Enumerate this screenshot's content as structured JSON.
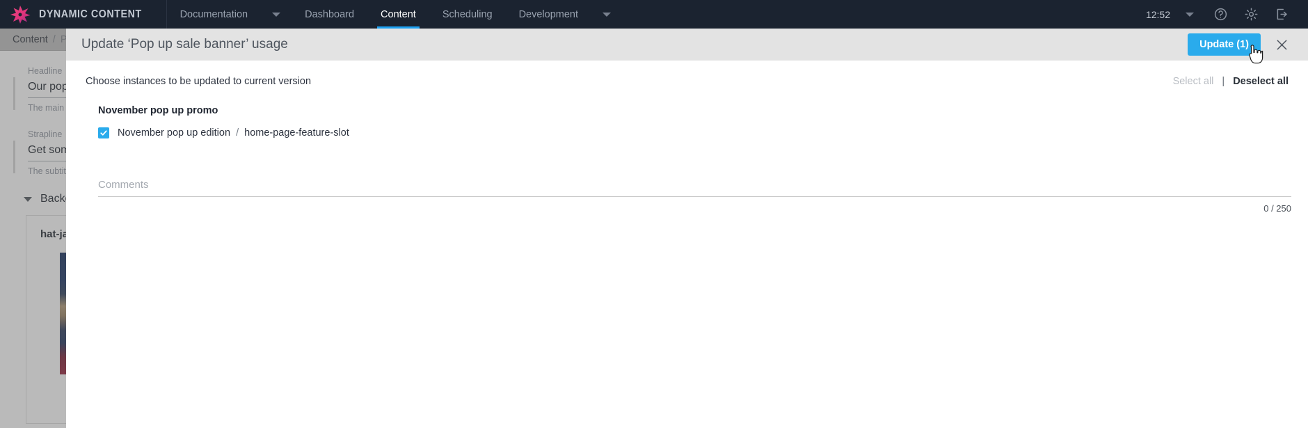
{
  "topnav": {
    "brand": "DYNAMIC CONTENT",
    "logo_icon": "starburst-logo-icon",
    "brand_color": "#e8417f",
    "items": [
      {
        "label": "Documentation",
        "active": false,
        "has_caret": true
      },
      {
        "label": "Dashboard",
        "active": false,
        "has_caret": false
      },
      {
        "label": "Content",
        "active": true,
        "has_caret": false
      },
      {
        "label": "Scheduling",
        "active": false,
        "has_caret": false
      },
      {
        "label": "Development",
        "active": false,
        "has_caret": true
      }
    ],
    "active_underline_color": "#1da1f2",
    "clock": "12:52",
    "right_icons": [
      {
        "name": "user-menu-chevron-icon"
      },
      {
        "name": "help-icon"
      },
      {
        "name": "gear-icon"
      },
      {
        "name": "logout-icon"
      }
    ]
  },
  "background_page": {
    "breadcrumb": {
      "current": "Content",
      "separator": "/",
      "next": "Po"
    },
    "fields": [
      {
        "label": "Headline",
        "value": "Our pop u",
        "hint": "The main t"
      },
      {
        "label": "Strapline",
        "value": "Get some",
        "hint": "The subtitl"
      }
    ],
    "section": {
      "label": "Backg",
      "expanded": true,
      "chevron_icon": "chevron-down-icon"
    },
    "asset": {
      "name": "hat-jac",
      "thumbnail_icon": "image-thumbnail"
    }
  },
  "modal": {
    "title": "Update ‘Pop up sale banner’ usage",
    "update_button": "Update (1)",
    "update_button_color": "#2aabec",
    "close_icon": "close-icon",
    "instruction": "Choose instances to be updated to current version",
    "select_all": "Select all",
    "divider": "|",
    "deselect_all": "Deselect all",
    "groups": [
      {
        "title": "November pop up promo",
        "instances": [
          {
            "checked": true,
            "name": "November pop up edition",
            "separator": "/",
            "slot": "home-page-feature-slot"
          }
        ]
      }
    ],
    "comments": {
      "placeholder": "Comments",
      "value": "",
      "counter": "0 / 250"
    }
  },
  "cursor": {
    "type": "pointer-hand"
  }
}
